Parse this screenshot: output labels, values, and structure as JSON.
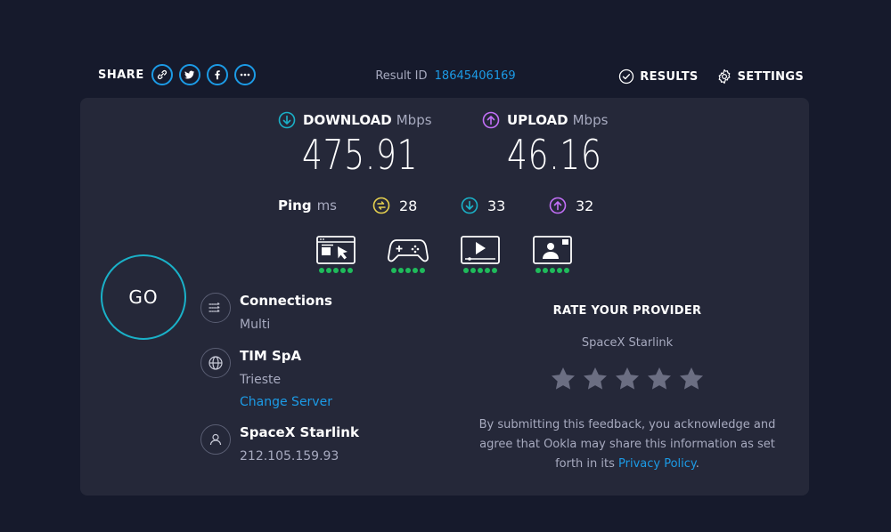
{
  "topbar": {
    "share_label": "SHARE",
    "share_icons": [
      "link-icon",
      "twitter-icon",
      "facebook-icon",
      "more-icon"
    ],
    "result_id_label": "Result ID",
    "result_id_value": "18645406169",
    "results_label": "RESULTS",
    "settings_label": "SETTINGS"
  },
  "speed": {
    "download": {
      "label": "DOWNLOAD",
      "unit": "Mbps",
      "value": "475.91",
      "color": "#1ab1c8"
    },
    "upload": {
      "label": "UPLOAD",
      "unit": "Mbps",
      "value": "46.16",
      "color": "#c26ff7"
    }
  },
  "ping": {
    "label": "Ping",
    "unit": "ms",
    "idle": "28",
    "download": "33",
    "upload": "32",
    "idle_color": "#e6d14e"
  },
  "usecases": [
    {
      "name": "web-browsing-icon",
      "rating": 5
    },
    {
      "name": "gaming-icon",
      "rating": 5
    },
    {
      "name": "streaming-icon",
      "rating": 5
    },
    {
      "name": "video-call-icon",
      "rating": 5
    }
  ],
  "go_label": "GO",
  "connections": {
    "title": "Connections",
    "value": "Multi"
  },
  "server": {
    "title": "TIM SpA",
    "location": "Trieste",
    "change_label": "Change Server"
  },
  "provider": {
    "title": "SpaceX Starlink",
    "ip": "212.105.159.93"
  },
  "rating": {
    "title": "RATE YOUR PROVIDER",
    "provider": "SpaceX Starlink",
    "star_count": 5,
    "disclaimer": "By submitting this feedback, you acknowledge and agree that Ookla may share this information as set forth in its",
    "privacy_link": "Privacy Policy",
    "period": "."
  },
  "colors": {
    "accent": "#1c9be6",
    "background": "#161a2c",
    "card": "#252839",
    "good": "#1fbb5b"
  }
}
